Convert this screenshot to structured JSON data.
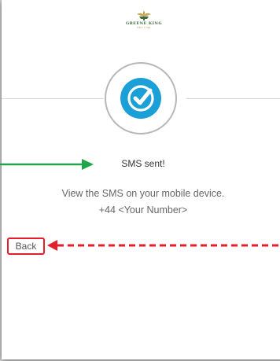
{
  "brand": {
    "name": "GREENE KING",
    "sub": "EST 1799"
  },
  "status": {
    "title": "SMS sent!",
    "message": "View the SMS on your mobile device.",
    "phone": "+44 <Your Number>"
  },
  "actions": {
    "back_label": "Back"
  },
  "colors": {
    "check_badge": "#1a9fd6",
    "badge_ring": "#b7b7b7",
    "annotation_green": "#22a54a",
    "annotation_red": "#e41e2a",
    "brand_green": "#3f6b3a",
    "brand_gold": "#b09240"
  },
  "icons": {
    "badge": "check-badge-icon",
    "logo": "greene-king-logo"
  }
}
